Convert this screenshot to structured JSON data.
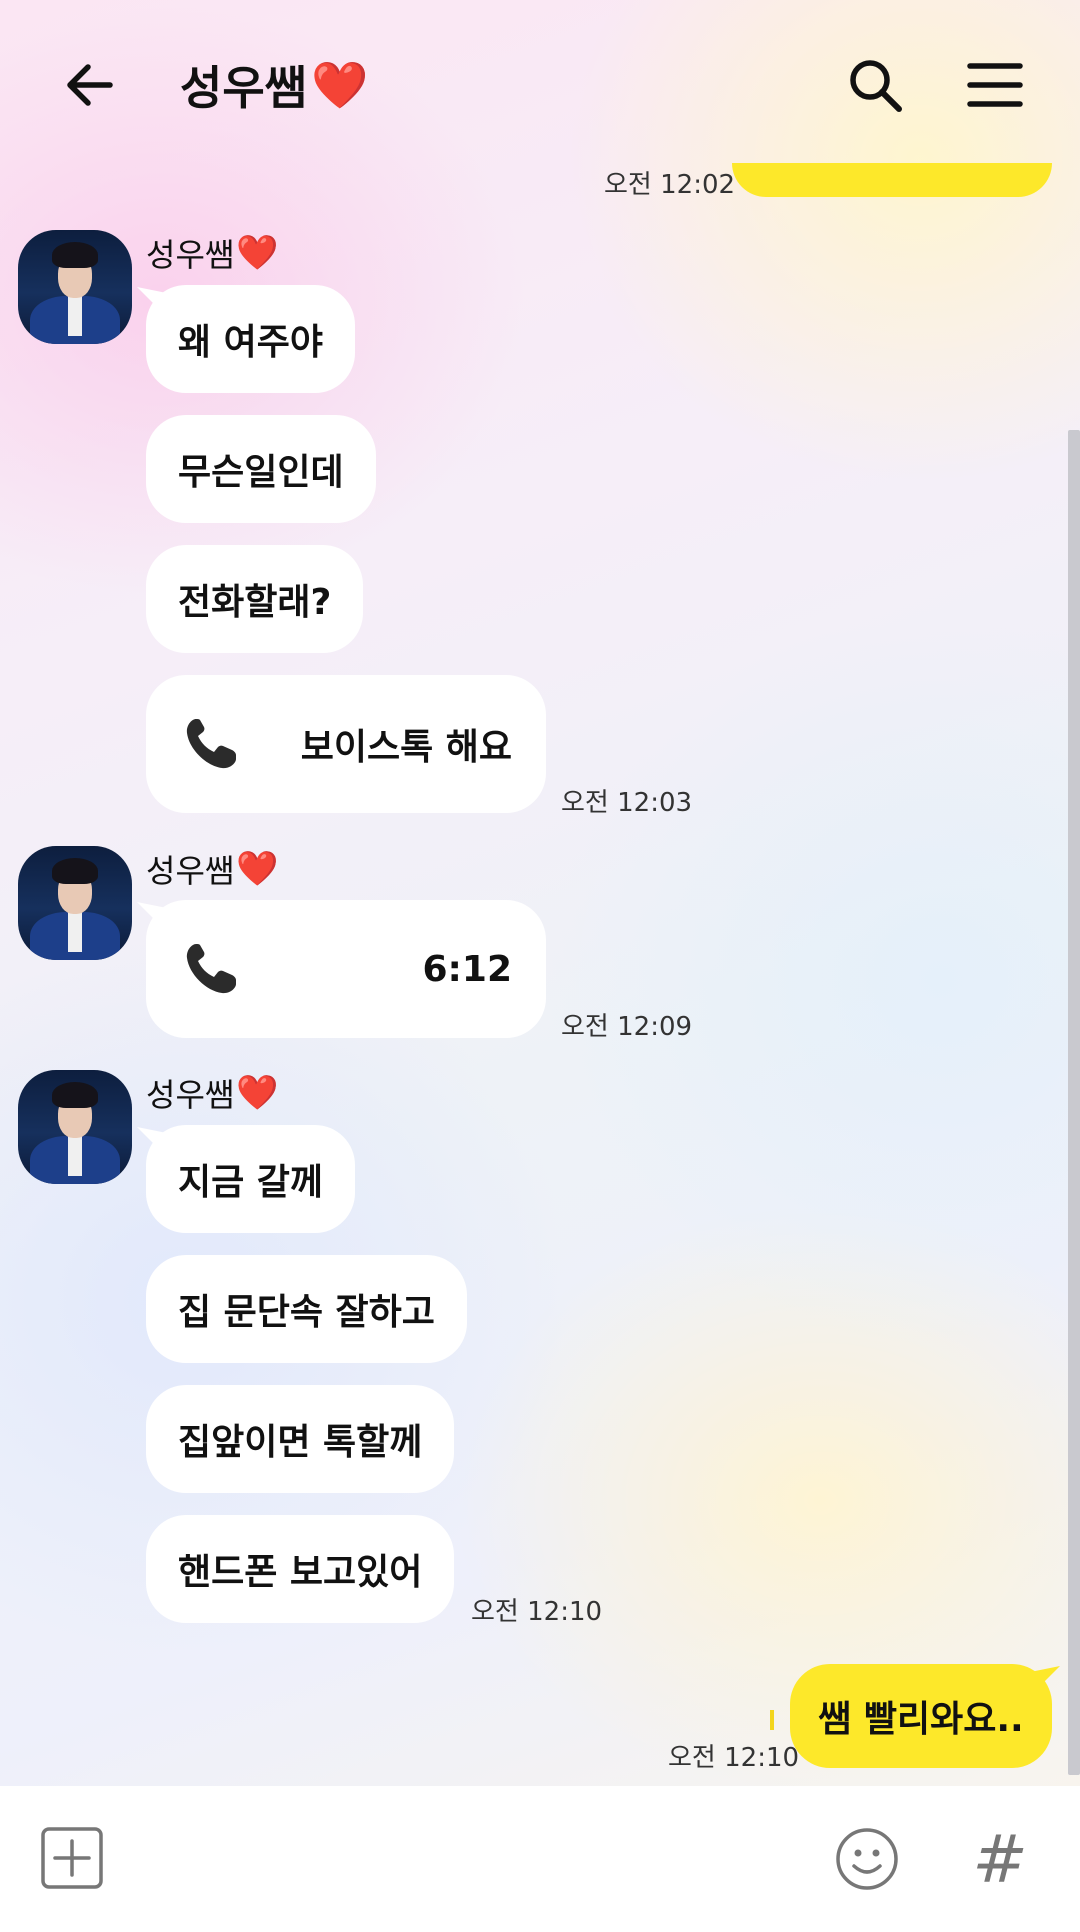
{
  "header": {
    "title": "성우쌤",
    "title_emoji": "❤️",
    "back_icon": "arrow-left-icon",
    "search_icon": "search-icon",
    "menu_icon": "hamburger-menu-icon"
  },
  "messages": {
    "prev_me": {
      "time": "오전 12:02"
    },
    "group1": {
      "sender": "성우쌤",
      "sender_emoji": "❤️",
      "texts": [
        "왜 여주야",
        "무슨일인데",
        "전화할래?"
      ],
      "call_label": "보이스톡 해요",
      "time": "오전 12:03"
    },
    "group2": {
      "sender": "성우쌤",
      "sender_emoji": "❤️",
      "call_duration": "6:12",
      "time": "오전 12:09"
    },
    "group3": {
      "sender": "성우쌤",
      "sender_emoji": "❤️",
      "texts": [
        "지금 갈께",
        "집 문단속 잘하고",
        "집앞이면 톡할께",
        "핸드폰 보고있어"
      ],
      "time": "오전 12:10"
    },
    "me_last": {
      "text": "쌤 빨리와요..",
      "time": "오전 12:10"
    }
  },
  "input_bar": {
    "add_icon": "plus-square-icon",
    "emoji_icon": "emoji-smile-icon",
    "hash_label": "#"
  },
  "colors": {
    "my_bubble": "#fde82a",
    "their_bubble": "#ffffff",
    "heart": "#e0102a"
  }
}
